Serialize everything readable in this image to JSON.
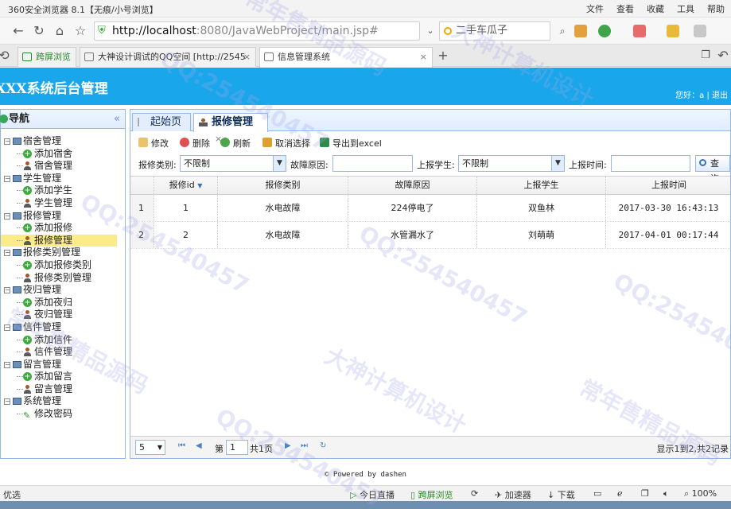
{
  "browser": {
    "window_title": "360安全浏览器 8.1【无痕/小号浏览】",
    "menus": [
      "文件",
      "查看",
      "收藏",
      "工具",
      "帮助"
    ],
    "url_host": "http://localhost",
    "url_rest": ":8080/JavaWebProject/main.jsp#",
    "search_text": "二手车瓜子",
    "tabs": [
      {
        "label": "跨屏浏览"
      },
      {
        "label": "大神设计调试的QQ空间 [http://2545"
      },
      {
        "label": "信息管理系统"
      }
    ]
  },
  "app": {
    "title": "XXX系统后台管理",
    "welcome": "您好：a | 退出"
  },
  "nav": {
    "header": "导航",
    "collapse": "«",
    "groups": [
      {
        "label": "宿舍管理",
        "items": [
          "添加宿舍",
          "宿舍管理"
        ]
      },
      {
        "label": "学生管理",
        "items": [
          "添加学生",
          "学生管理"
        ]
      },
      {
        "label": "报修管理",
        "items": [
          "添加报修",
          "报修管理"
        ]
      },
      {
        "label": "报修类别管理",
        "items": [
          "添加报修类别",
          "报修类别管理"
        ]
      },
      {
        "label": "夜归管理",
        "items": [
          "添加夜归",
          "夜归管理"
        ]
      },
      {
        "label": "信件管理",
        "items": [
          "添加信件",
          "信件管理"
        ]
      },
      {
        "label": "留言管理",
        "items": [
          "添加留言",
          "留言管理"
        ]
      },
      {
        "label": "系统管理",
        "items": [
          "修改密码"
        ]
      }
    ]
  },
  "main": {
    "tabs": [
      {
        "label": "起始页"
      },
      {
        "label": "报修管理",
        "close": "×"
      }
    ],
    "toolbar": {
      "edit": "修改",
      "delete": "删除",
      "refresh": "刷新",
      "unselect": "取消选择",
      "export": "导出到excel"
    },
    "filters": {
      "type_label": "报修类别:",
      "type_value": "不限制",
      "reason_label": "故障原因:",
      "student_label": "上报学生:",
      "student_value": "不限制",
      "time_label": "上报时间:",
      "search_btn": "查询"
    },
    "grid": {
      "columns": [
        "报修id",
        "报修类别",
        "故障原因",
        "上报学生",
        "上报时间"
      ],
      "rows": [
        {
          "num": "1",
          "id": "1",
          "type": "水电故障",
          "reason": "224停电了",
          "student": "双鱼林",
          "time": "2017-03-30 16:43:13"
        },
        {
          "num": "2",
          "id": "2",
          "type": "水电故障",
          "reason": "水管漏水了",
          "student": "刘萌萌",
          "time": "2017-04-01 00:17:44"
        }
      ]
    },
    "pager": {
      "page_size": "5",
      "page_label": "第",
      "page": "1",
      "total_pages": "共1页",
      "info": "显示1到2,共2记录"
    }
  },
  "footer": "© Powered by dashen",
  "statusbar": {
    "left": "优选",
    "items": [
      "今日直播",
      "跨屏浏览",
      "加速器",
      "下载",
      "100%"
    ]
  },
  "watermarks": [
    "QQ:254540457",
    "大神计算机设计",
    "常年售精品源码"
  ]
}
